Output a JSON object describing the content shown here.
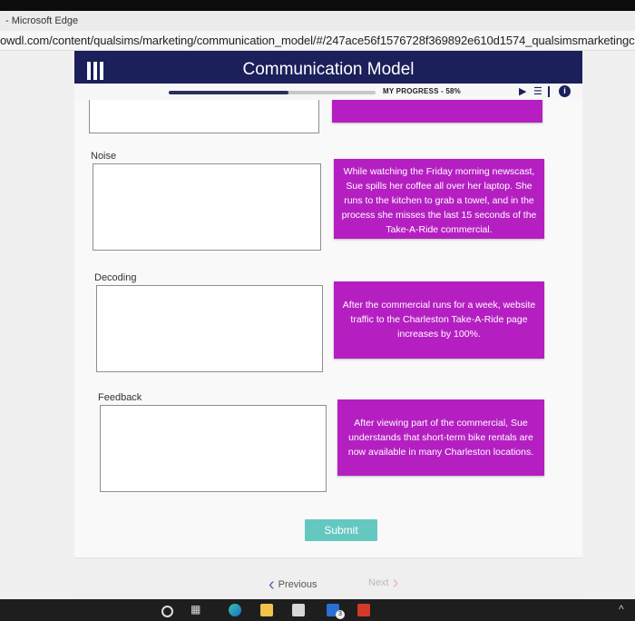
{
  "browser": {
    "window_title": "- Microsoft Edge",
    "url": "owdl.com/content/qualsims/marketing/communication_model/#/247ace56f1576728f369892e610d1574_qualsimsmarketingcommu"
  },
  "header": {
    "title": "Communication Model",
    "menu_icon": "hamburger-menu-icon"
  },
  "progress": {
    "label": "MY PROGRESS - 58%",
    "percent": 58
  },
  "controls": {
    "play_icon": "play-icon",
    "list_icon": "list-icon",
    "info_icon": "info-icon",
    "info_glyph": "i"
  },
  "fields": [
    {
      "label": "Noise"
    },
    {
      "label": "Decoding"
    },
    {
      "label": "Feedback"
    }
  ],
  "cards": [
    {
      "text": "While watching the Friday morning newscast, Sue spills her coffee all over her laptop. She runs to the kitchen to grab a towel, and in the process she misses the last 15 seconds of the Take-A-Ride commercial."
    },
    {
      "text": "After the commercial runs for a week, website traffic to the Charleston Take-A-Ride page increases by 100%."
    },
    {
      "text": "After viewing part of the commercial, Sue understands that short-term bike rentals are now available in many Charleston locations."
    }
  ],
  "actions": {
    "submit": "Submit",
    "previous": "Previous",
    "next": "Next"
  },
  "taskbar": {
    "mail_badge": "3"
  },
  "colors": {
    "header_bg": "#1b1f5a",
    "card_bg": "#b51fc2",
    "submit_bg": "#64c8c0"
  }
}
